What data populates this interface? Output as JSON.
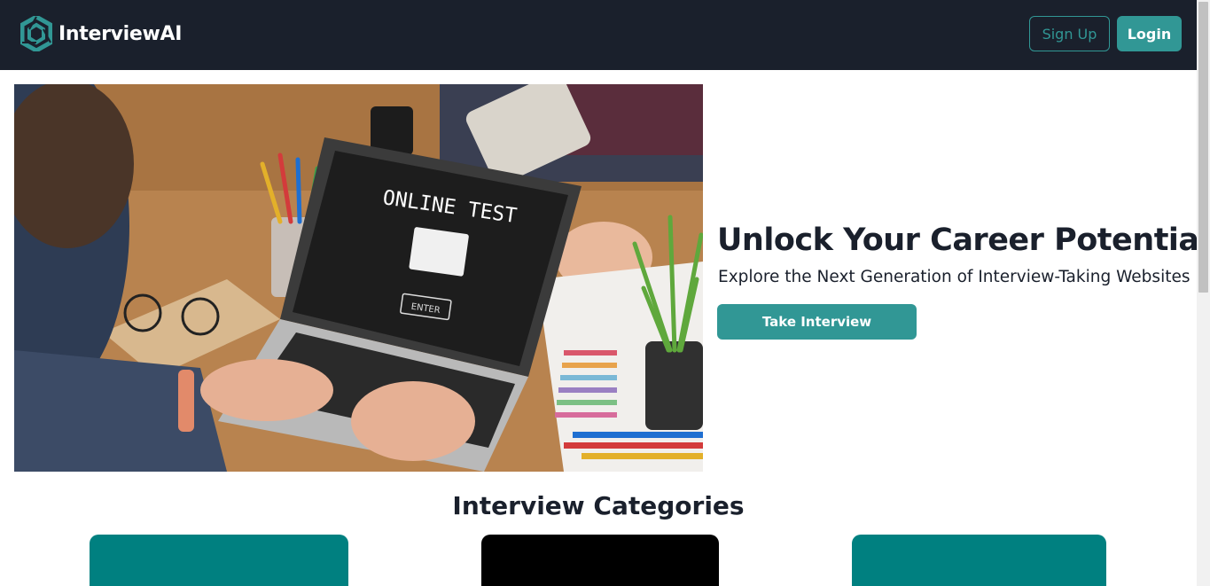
{
  "header": {
    "brand_name": "InterviewAI",
    "signup_label": "Sign Up",
    "login_label": "Login"
  },
  "hero": {
    "image_screen_title": "ONLINE TEST",
    "image_screen_button": "ENTER",
    "title": "Unlock Your Career Potential",
    "subtitle": "Explore the Next Generation of Interview-Taking Websites",
    "cta_label": "Take Interview"
  },
  "categories": {
    "heading": "Interview Categories",
    "cards": [
      {
        "color": "#008080"
      },
      {
        "color": "#000000"
      },
      {
        "color": "#008080"
      }
    ]
  },
  "colors": {
    "navbar": "#1a202c",
    "accent": "#319795",
    "text": "#1a202c"
  }
}
